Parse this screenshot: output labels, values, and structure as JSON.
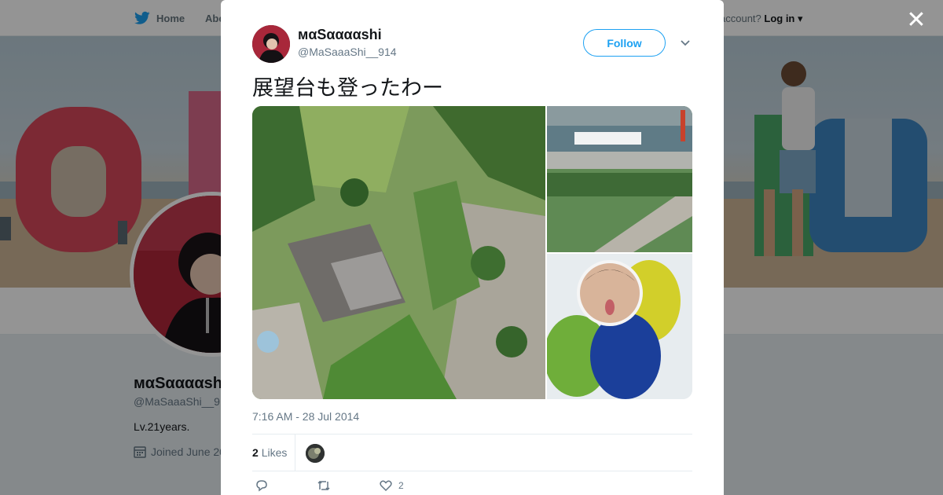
{
  "nav": {
    "home_label": "Home",
    "about_label": "Abo",
    "account_prompt": "account?",
    "login_label": "Log in"
  },
  "profile": {
    "name": "мαSααααshi",
    "handle": "@MaSaaaShi__9",
    "bio": "Lv.21years.",
    "joined": "Joined June 20"
  },
  "tweet": {
    "author_name": "мαSααααshi",
    "author_handle": "@MaSaaaShi__914",
    "follow_label": "Follow",
    "text": "展望台も登ったわー",
    "timestamp": "7:16 AM - 28 Jul 2014",
    "likes_count": "2",
    "likes_label": "Likes",
    "like_action_count": "2"
  },
  "icons": {
    "twitter": "bird-icon",
    "close": "close-icon",
    "caret": "chevron-down-icon",
    "reply": "reply-icon",
    "retweet": "retweet-icon",
    "like": "heart-icon",
    "calendar": "calendar-icon"
  },
  "colors": {
    "accent": "#1da1f2",
    "text": "#14171a",
    "secondary": "#657786",
    "overlay": "rgba(0,0,0,0.42)"
  }
}
